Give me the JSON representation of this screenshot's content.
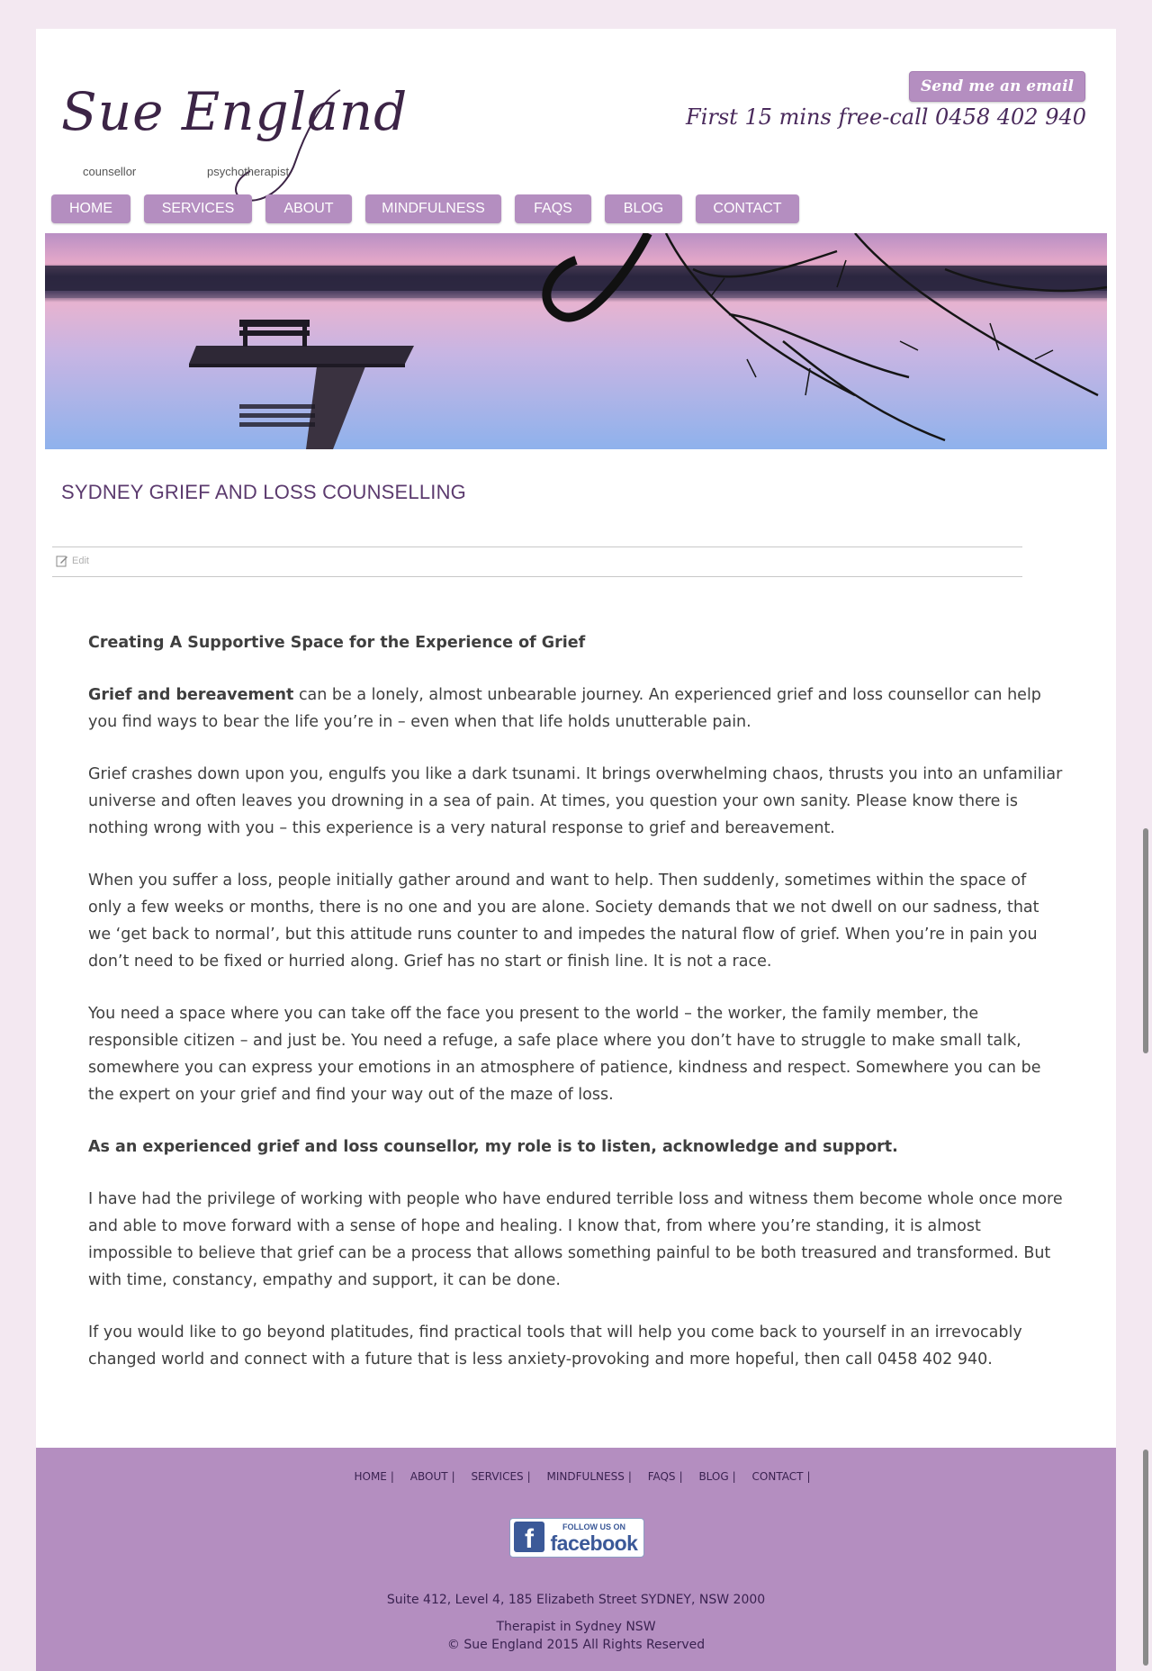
{
  "header": {
    "logo_name": "Sue England",
    "logo_sub_left": "counsellor",
    "logo_sub_right": "psychotherapist",
    "email_button": "Send me an email",
    "phone_text": "First 15 mins free-call 0458 402 940"
  },
  "nav": [
    "HOME",
    "SERVICES",
    "ABOUT",
    "MINDFULNESS",
    "FAQS",
    "BLOG",
    "CONTACT"
  ],
  "page_title": "SYDNEY GRIEF AND LOSS COUNSELLING",
  "edit_label": "Edit",
  "content": {
    "heading": "Creating A Supportive Space for the Experience of Grief",
    "p1_bold": "Grief and bereavement",
    "p1_rest": " can be a lonely, almost unbearable journey.  An experienced grief and loss counsellor can help you find ways to bear the life you’re in – even when that life holds unutterable pain.",
    "p2": "Grief crashes down upon you, engulfs you like a dark tsunami.  It brings overwhelming chaos, thrusts you into an unfamiliar universe and often leaves you drowning in a sea of pain.  At times, you question your own sanity.  Please know there is nothing wrong with you – this experience is a very natural response to grief and bereavement.",
    "p3": "When you suffer a loss, people initially gather around and want to help.  Then suddenly, sometimes within the space of only a few weeks or months, there is no one and you are alone.  Society demands that we not dwell on our sadness, that we ‘get back to normal’, but this attitude runs counter to and impedes the natural flow of grief. When you’re in pain you don’t need to be fixed or hurried along.  Grief has no start or finish line.  It is not a race.",
    "p4": "You need a space where you can take off the face you present to the world – the worker, the family member, the responsible citizen – and just be.  You need a refuge, a safe place where you don’t have to struggle to make small talk, somewhere you can express your emotions in an atmosphere of patience, kindness and respect.  Somewhere you can be the expert on your grief and find your way out of the maze of loss.",
    "p5_bold": "As an experienced grief and loss counsellor, my role is to listen, acknowledge and support.",
    "p6": "I have had the privilege of working with people who have endured terrible loss and witness them become whole once more and able to move forward with a sense of hope and healing.  I know that, from where you’re standing, it is almost impossible to believe that grief can be a process that allows something painful to be both treasured and transformed.  But with time, constancy, empathy and support, it can be done.",
    "p7": "If you would like to go beyond platitudes, find practical tools that will help you come back to yourself in an irrevocably changed world and connect with a future that is less anxiety-provoking and more hopeful, then call 0458 402 940."
  },
  "footer": {
    "nav": [
      "HOME",
      "ABOUT",
      "SERVICES",
      "MINDFULNESS",
      "FAQS",
      "BLOG",
      "CONTACT"
    ],
    "separator": "|",
    "fb_follow": "FOLLOW US ON",
    "fb_word": "facebook",
    "address": "Suite 412, Level 4, 185 Elizabeth Street SYDNEY, NSW 2000",
    "tagline": "Therapist in Sydney NSW",
    "copyright": "© Sue England 2015 All Rights Reserved"
  },
  "colors": {
    "accent": "#b48ec0",
    "title": "#5b3a6e",
    "page_bg": "#f3e8f1"
  },
  "icons": {
    "edit": "edit-icon",
    "facebook": "facebook-logo-icon"
  }
}
